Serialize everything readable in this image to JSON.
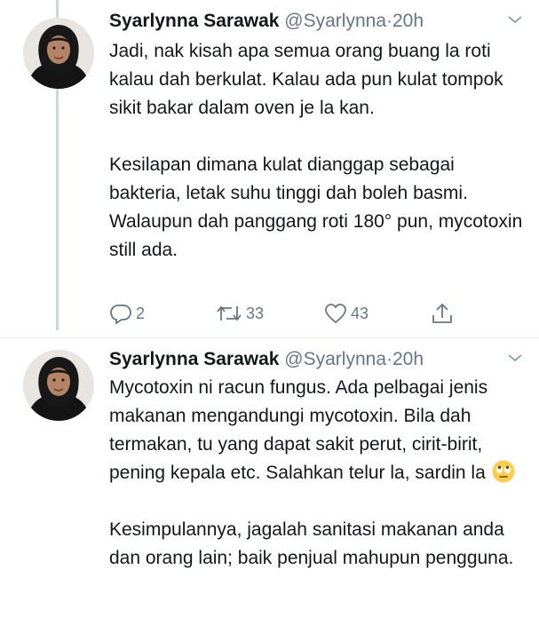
{
  "tweets": [
    {
      "author_name": "Syarlynna Sarawak",
      "handle": "@Syarlynna",
      "separator": "·",
      "time": "20h",
      "paragraphs": [
        "Jadi, nak kisah apa semua orang buang la roti kalau dah berkulat. Kalau ada pun kulat tompok sikit bakar dalam oven je la kan.",
        "Kesilapan dimana kulat dianggap sebagai bakteria, letak suhu tinggi dah boleh basmi. Walaupun dah panggang roti 180° pun, mycotoxin still ada."
      ],
      "replies": "2",
      "retweets": "33",
      "likes": "43"
    },
    {
      "author_name": "Syarlynna Sarawak",
      "handle": "@Syarlynna",
      "separator": "·",
      "time": "20h",
      "paragraph_1_text": "Mycotoxin ni racun fungus. Ada pelbagai jenis makanan mengandungi mycotoxin. Bila dah termakan, tu yang dapat sakit perut, cirit-birit, pening kepala etc. Salahkan telur la, sardin la",
      "paragraph_1_emoji": "face-with-rolling-eyes",
      "paragraph_2_text": "Kesimpulannya, jagalah sanitasi makanan anda dan orang lain; baik penjual mahupun pengguna."
    }
  ],
  "icons": {
    "reply": "reply-icon",
    "retweet": "retweet-icon",
    "like": "heart-icon",
    "share": "share-icon",
    "menu": "chevron-down-icon"
  },
  "colors": {
    "text": "#14171a",
    "secondary": "#657786",
    "thread_line": "#ccd6dd"
  }
}
